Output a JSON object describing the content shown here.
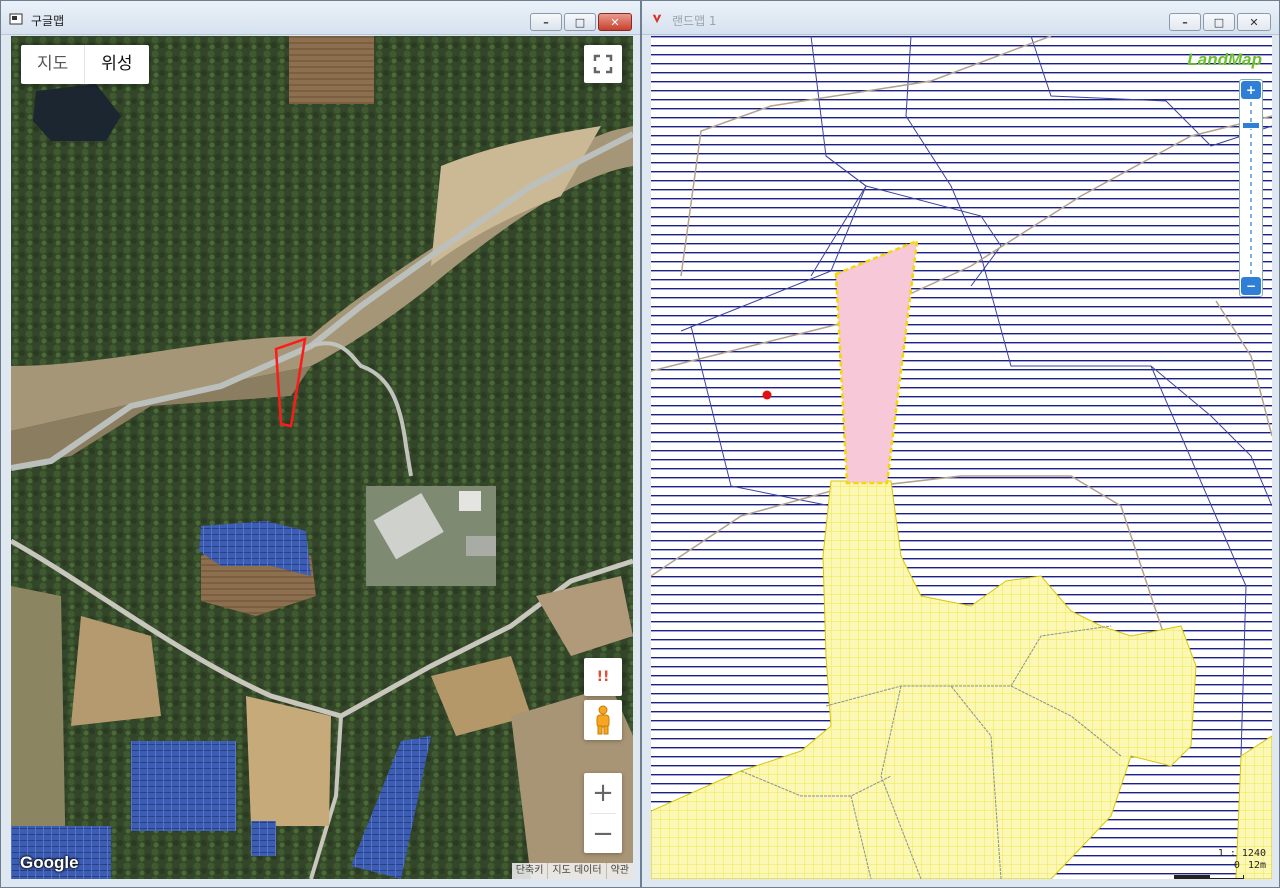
{
  "google_window": {
    "title": "구글맵",
    "controls": {
      "minimize": "–",
      "maximize": "□",
      "close": "✕"
    },
    "map_type": {
      "map_label": "지도",
      "satellite_label": "위성",
      "selected": "위성"
    },
    "buttons": {
      "fullscreen": "fullscreen",
      "report": "!!",
      "pegman": "pegman",
      "zoom_in": "+",
      "zoom_out": "−"
    },
    "logo": "Google",
    "attribution": [
      "단축키",
      "지도 데이터",
      "약관"
    ],
    "parcel_outline_color": "#ff1a1a"
  },
  "landmap_window": {
    "title": "랜드맵 1",
    "controls": {
      "minimize": "–",
      "maximize": "□",
      "close": "✕"
    },
    "logo": "LandMap",
    "zoom": {
      "in": "+",
      "out": "−"
    },
    "scale": {
      "ratio": "1 : 1240",
      "start": "0",
      "end": "12m"
    },
    "colors": {
      "hatch_lines": "#1a2088",
      "yellow_zone": "#fbf7b4",
      "selected_parcel": "#f7c8d8",
      "selected_outline": "#f5d800",
      "marker": "#e01010",
      "road_line": "#b3a28c"
    }
  }
}
